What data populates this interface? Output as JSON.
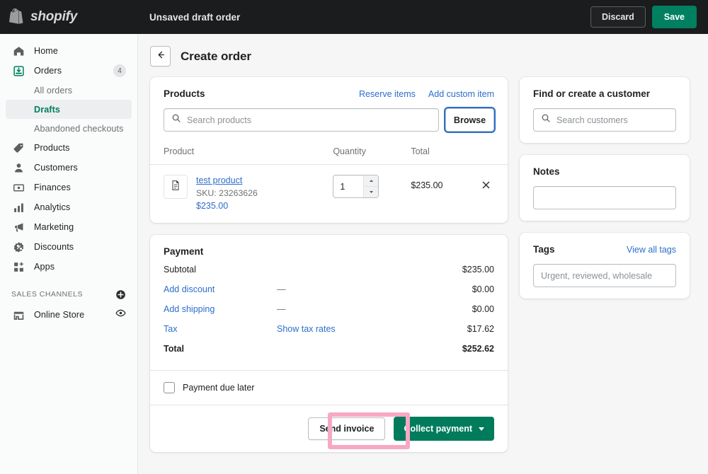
{
  "topbar": {
    "brand": "shopify",
    "brand_logo_icon": "shopify-bag-icon",
    "title": "Unsaved draft order",
    "discard_label": "Discard",
    "save_label": "Save"
  },
  "sidebar": {
    "items": [
      {
        "label": "Home",
        "icon": "home-icon"
      },
      {
        "label": "Orders",
        "icon": "orders-inbox-icon",
        "badge": "4",
        "active_section": true
      },
      {
        "label": "All orders",
        "sub": true
      },
      {
        "label": "Drafts",
        "sub": true,
        "active": true
      },
      {
        "label": "Abandoned checkouts",
        "sub": true
      },
      {
        "label": "Products",
        "icon": "tag-icon"
      },
      {
        "label": "Customers",
        "icon": "person-icon"
      },
      {
        "label": "Finances",
        "icon": "banknote-icon"
      },
      {
        "label": "Analytics",
        "icon": "bar-chart-icon"
      },
      {
        "label": "Marketing",
        "icon": "megaphone-icon"
      },
      {
        "label": "Discounts",
        "icon": "discount-badge-icon"
      },
      {
        "label": "Apps",
        "icon": "apps-grid-plus-icon"
      }
    ],
    "section": {
      "label": "SALES CHANNELS",
      "add_icon": "plus-circle-icon",
      "channel": {
        "label": "Online Store",
        "icon": "storefront-icon",
        "view_icon": "eye-icon"
      }
    }
  },
  "page": {
    "back_icon": "arrow-left-icon",
    "title": "Create order"
  },
  "products_card": {
    "title": "Products",
    "reserve_items_label": "Reserve items",
    "add_custom_item_label": "Add custom item",
    "search_placeholder": "Search products",
    "search_value": "",
    "search_icon": "search-icon",
    "browse_label": "Browse",
    "columns": {
      "product": "Product",
      "quantity": "Quantity",
      "total": "Total"
    },
    "rows": [
      {
        "name": "test product",
        "sku": "SKU: 23263626",
        "price": "$235.00",
        "quantity": "1",
        "total": "$235.00",
        "thumb_icon": "document-icon",
        "remove_icon": "close-icon"
      }
    ]
  },
  "payment_card": {
    "title": "Payment",
    "rows": [
      {
        "label": "Subtotal",
        "mid": "",
        "amount": "$235.00",
        "label_link": false,
        "mid_link": false,
        "bold": false
      },
      {
        "label": "Add discount",
        "mid": "—",
        "amount": "$0.00",
        "label_link": true,
        "mid_link": false,
        "bold": false
      },
      {
        "label": "Add shipping",
        "mid": "—",
        "amount": "$0.00",
        "label_link": true,
        "mid_link": false,
        "bold": false
      },
      {
        "label": "Tax",
        "mid": "Show tax rates",
        "amount": "$17.62",
        "label_link": true,
        "mid_link": true,
        "bold": false
      },
      {
        "label": "Total",
        "mid": "",
        "amount": "$252.62",
        "label_link": false,
        "mid_link": false,
        "bold": true
      }
    ],
    "due_later_label": "Payment due later",
    "due_later_checked": false,
    "send_invoice_label": "Send invoice",
    "collect_payment_label": "Collect payment",
    "collect_caret_icon": "chevron-down-icon",
    "highlight_color": "#f7a8c4",
    "highlight_target": "send-invoice-button"
  },
  "customer_card": {
    "title": "Find or create a customer",
    "search_placeholder": "Search customers",
    "search_value": "",
    "search_icon": "search-icon"
  },
  "notes_card": {
    "title": "Notes",
    "value": "",
    "placeholder": ""
  },
  "tags_card": {
    "title": "Tags",
    "view_all_label": "View all tags",
    "placeholder": "Urgent, reviewed, wholesale",
    "value": ""
  },
  "colors": {
    "brand_green": "#008060",
    "link_blue": "#2c6ecb",
    "topbar_bg": "#1a1c1d",
    "page_bg": "#f6f6f7",
    "highlight_pink": "#f7a8c4"
  }
}
